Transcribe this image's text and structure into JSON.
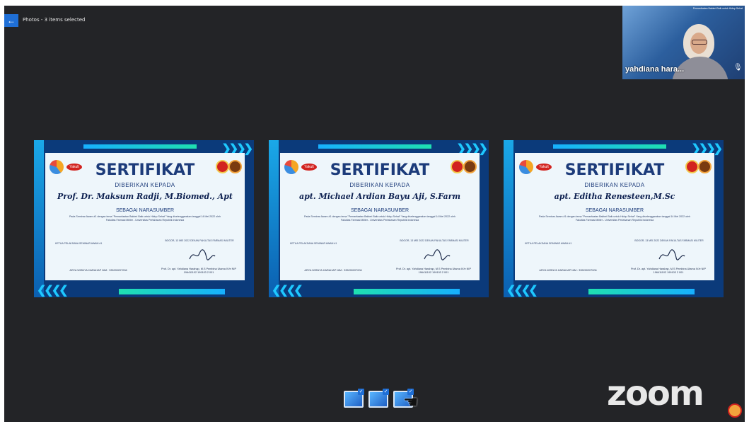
{
  "topbar": {
    "back_icon": "arrow-left-icon",
    "title": "Photos - 3 items selected"
  },
  "video": {
    "banner": "Pemanfaatan Bakteri Baik untuk Hidup Sehat",
    "participant_name": "yahdiana hara...",
    "icon": "microphone-icon"
  },
  "certificates": [
    {
      "heading": "SERTIFIKAT",
      "given_to": "DIBERIKAN KEPADA",
      "name": "Prof. Dr. Maksum Radji, M.Biomed., Apt",
      "role": "SEBAGAI NARASUMBER",
      "desc": "Pada Seminar Awam #1 dengan tema \"Pemanfaatan Bakteri Baik untuk Hidup Sehat\" Yang diselenggarakan tanggal 14 Mei 2022 oleh Fakultas Farmasi Militer - Universitas Pertahanan Republik Indonesia",
      "sig_left_title": "KETUA PELAKSANA SEMINAR AWAM #1",
      "sig_right_title": "BOGOR, 13 MEI 2022 DEKAN FAKULTAS FARMASI MILITER",
      "sig_left_name": "ARYA WISNYA HARAHAP NIM : 335200207006",
      "sig_right_name": "Prof. Dr. apt. Yahdiana Harahap, M.S Pembina Utama IV/e NIP 196411102 199103 2 001"
    },
    {
      "heading": "SERTIFIKAT",
      "given_to": "DIBERIKAN KEPADA",
      "name": "apt. Michael Ardian Bayu Aji, S.Farm",
      "role": "SEBAGAI NARASUMBER",
      "desc": "Pada Seminar Awam #1 dengan tema \"Pemanfaatan Bakteri Baik untuk Hidup Sehat\" Yang diselenggarakan tanggal 14 Mei 2022 oleh Fakultas Farmasi Militer - Universitas Pertahanan Republik Indonesia",
      "sig_left_title": "KETUA PELAKSANA SEMINAR AWAM #1",
      "sig_right_title": "BOGOR, 13 MEI 2022 DEKAN FAKULTAS FARMASI MILITER",
      "sig_left_name": "ARYA WISNYA HARAHAP NIM : 335200207006",
      "sig_right_name": "Prof. Dr. apt. Yahdiana Harahap, M.S Pembina Utama IV/e NIP 196411102 199103 2 001"
    },
    {
      "heading": "SERTIFIKAT",
      "given_to": "DIBERIKAN KEPADA",
      "name": "apt. Editha Renesteen,M.Sc",
      "role": "SEBAGAI NARASUMBER",
      "desc": "Pada Seminar Awam #1 dengan tema \"Pemanfaatan Bakteri Baik untuk Hidup Sehat\" Yang diselenggarakan tanggal 14 Mei 2022 oleh Fakultas Farmasi Militer - Universitas Pertahanan Republik Indonesia",
      "sig_left_title": "KETUA PELAKSANA SEMINAR AWAM #1",
      "sig_right_title": "BOGOR, 13 MEI 2022 DEKAN FAKULTAS FARMASI MILITER",
      "sig_left_name": "ARYA WISNYA HARAHAP NIM : 335200207006",
      "sig_right_name": "Prof. Dr. apt. Yahdiana Harahap, M.S Pembina Utama IV/e NIP 196411102 199103 2 001"
    }
  ],
  "thumbnails": {
    "count": 3,
    "check_icon": "check-icon",
    "cursor": "hand-cursor-icon"
  },
  "branding": {
    "zoom_logo": "zoom",
    "badge_icon": "university-seal-icon"
  }
}
